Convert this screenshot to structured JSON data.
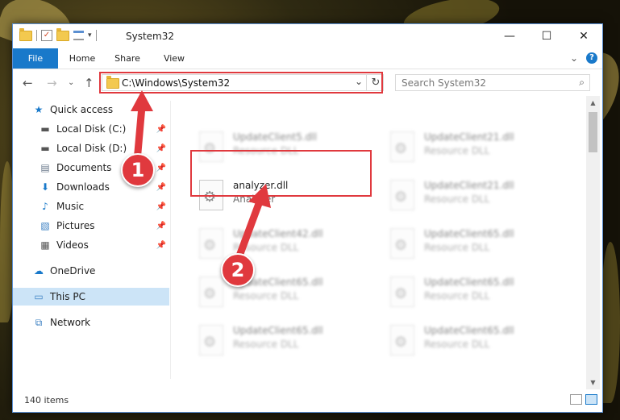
{
  "window": {
    "title": "System32",
    "buttons": {
      "minimize": "—",
      "maximize": "☐",
      "close": "✕"
    }
  },
  "ribbon": {
    "tabs": [
      "File",
      "Home",
      "Share",
      "View"
    ],
    "collapse": "⌄",
    "help": "?"
  },
  "address": {
    "path": "C:\\Windows\\System32",
    "refresh": "↻",
    "dropdown": "⌄"
  },
  "search": {
    "placeholder": "Search System32",
    "icon": "⌕"
  },
  "nav": {
    "back": "←",
    "forward": "→",
    "recent": "⌄",
    "up": "↑"
  },
  "sidebar": {
    "items": [
      {
        "label": "Quick access",
        "icon": "star-icon",
        "glyph": "★",
        "color": "#1979ca",
        "pinned": false
      },
      {
        "label": "Local Disk (C:)",
        "icon": "drive-icon",
        "glyph": "▬",
        "color": "#555555",
        "pinned": true
      },
      {
        "label": "Local Disk (D:)",
        "icon": "drive-icon",
        "glyph": "▬",
        "color": "#555555",
        "pinned": true
      },
      {
        "label": "Documents",
        "icon": "documents-icon",
        "glyph": "▤",
        "color": "#6d7b8d",
        "pinned": true
      },
      {
        "label": "Downloads",
        "icon": "download-icon",
        "glyph": "⬇",
        "color": "#1979ca",
        "pinned": true
      },
      {
        "label": "Music",
        "icon": "music-icon",
        "glyph": "♪",
        "color": "#1979ca",
        "pinned": true
      },
      {
        "label": "Pictures",
        "icon": "pictures-icon",
        "glyph": "▧",
        "color": "#3a7fc2",
        "pinned": true
      },
      {
        "label": "Videos",
        "icon": "videos-icon",
        "glyph": "▦",
        "color": "#555555",
        "pinned": true
      },
      {
        "label": "OneDrive",
        "icon": "cloud-icon",
        "glyph": "☁",
        "color": "#1979ca",
        "pinned": false
      },
      {
        "label": "This PC",
        "icon": "computer-icon",
        "glyph": "▭",
        "color": "#3a7fc2",
        "pinned": false,
        "selected": true
      },
      {
        "label": "Network",
        "icon": "network-icon",
        "glyph": "⧉",
        "color": "#3a7fc2",
        "pinned": false
      }
    ],
    "pin_glyph": "📌"
  },
  "files": {
    "left": [
      {
        "name": "UpdateClient5.dll",
        "desc": "Resource DLL",
        "blurred": true
      },
      {
        "name": "analyzer.dll",
        "desc": "Analyzer",
        "blurred": false,
        "highlighted": true
      },
      {
        "name": "UpdateClient42.dll",
        "desc": "Resource DLL",
        "blurred": true
      },
      {
        "name": "UpdateClient65.dll",
        "desc": "Resource DLL",
        "blurred": true
      },
      {
        "name": "UpdateClient65.dll",
        "desc": "Resource DLL",
        "blurred": true
      }
    ],
    "right": [
      {
        "name": "UpdateClient21.dll",
        "desc": "Resource DLL",
        "blurred": true
      },
      {
        "name": "UpdateClient21.dll",
        "desc": "Resource DLL",
        "blurred": true
      },
      {
        "name": "UpdateClient65.dll",
        "desc": "Resource DLL",
        "blurred": true
      },
      {
        "name": "UpdateClient65.dll",
        "desc": "Resource DLL",
        "blurred": true
      },
      {
        "name": "UpdateClient65.dll",
        "desc": "Resource DLL",
        "blurred": true
      }
    ]
  },
  "status": {
    "item_count": "140 items"
  },
  "annotations": {
    "step1": "1",
    "step2": "2",
    "color": "#e0393e"
  }
}
